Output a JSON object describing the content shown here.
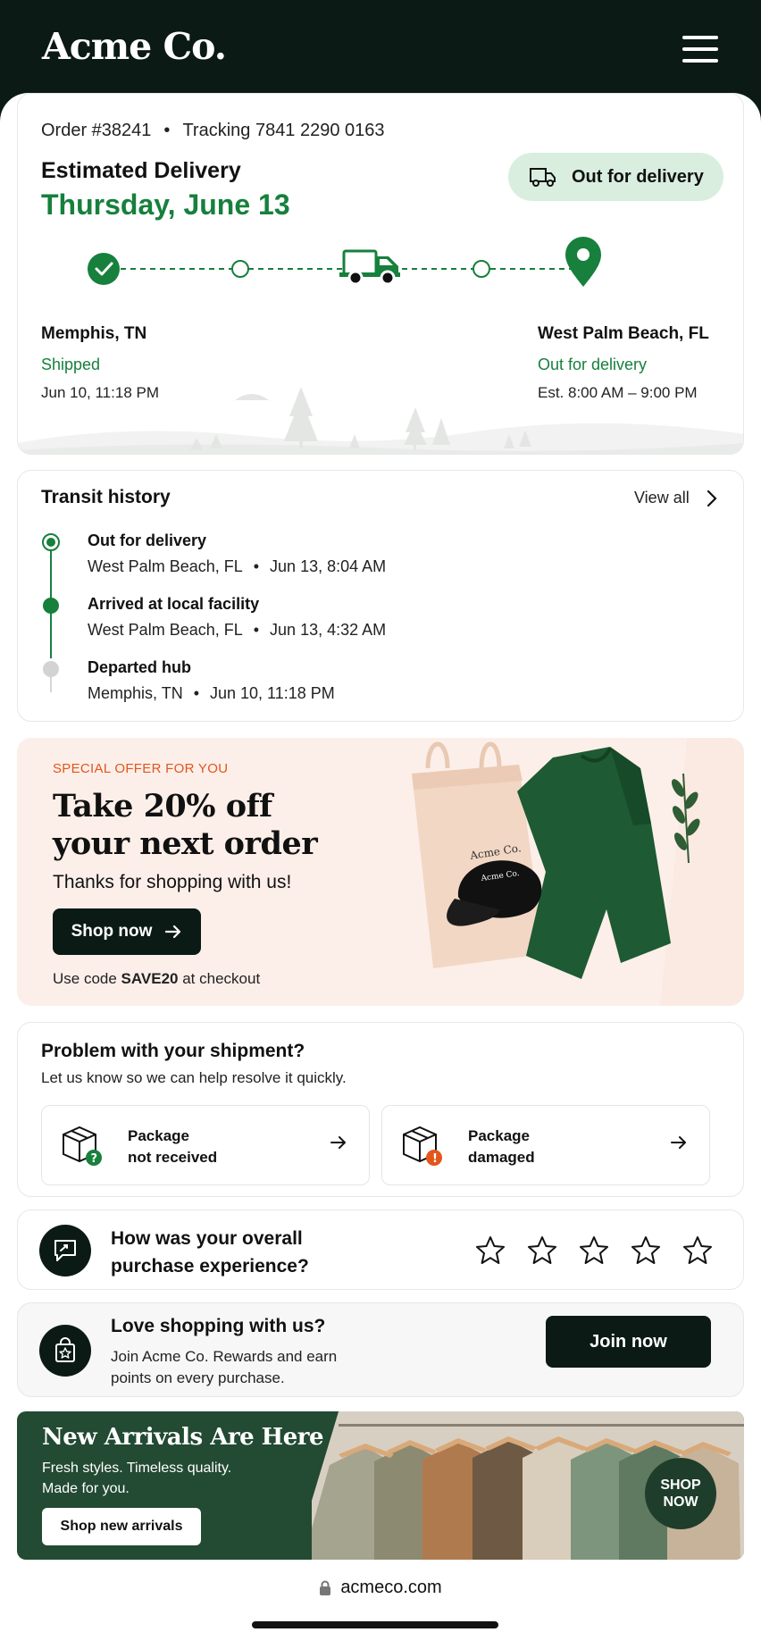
{
  "app": {
    "brand": "Acme Co."
  },
  "order": {
    "number": "Order #38241",
    "separator": "•",
    "tracking": "Tracking 7841 2290 0163",
    "estimated_label": "Estimated Delivery",
    "estimated_date": "Thursday, June 13",
    "status_pill": "Out for delivery"
  },
  "route": {
    "origin": {
      "city": "Memphis, TN",
      "status": "Shipped",
      "time": "Jun 10, 11:18 PM"
    },
    "destination": {
      "city": "West Palm Beach, FL",
      "status": "Out for delivery",
      "time": "Est. 8:00 AM – 9:00 PM"
    }
  },
  "transit": {
    "title": "Transit history",
    "view_all": "View all",
    "events": [
      {
        "title": "Out for delivery",
        "location": "West Palm Beach, FL",
        "time": "Jun 13, 8:04 AM"
      },
      {
        "title": "Arrived at local facility",
        "location": "West Palm Beach, FL",
        "time": "Jun 13, 4:32 AM"
      },
      {
        "title": "Departed hub",
        "location": "Memphis, TN",
        "time": "Jun 10, 11:18 PM"
      }
    ]
  },
  "promo": {
    "kicker": "SPECIAL OFFER FOR YOU",
    "headline": "Take 20% off your next order",
    "subtitle": "Thanks for shopping with us!",
    "button": "Shop now",
    "code_prefix": "Use code ",
    "code": "SAVE20",
    "code_suffix": " at checkout",
    "product_brand": "Acme Co."
  },
  "problem": {
    "title": "Problem with your shipment?",
    "subtitle": "Let us know so we can help resolve it quickly.",
    "options": [
      {
        "line1": "Package",
        "line2": "not received"
      },
      {
        "line1": "Package",
        "line2": "damaged"
      }
    ]
  },
  "rating": {
    "question": "How was your overall purchase experience?",
    "max_stars": 5,
    "selected": 0
  },
  "rewards": {
    "title": "Love shopping with us?",
    "subtitle": "Join Acme Co. Rewards and earn points on every purchase.",
    "button": "Join now"
  },
  "arrivals": {
    "title": "New Arrivals Are Here",
    "subtitle": "Fresh styles. Timeless quality. Made for you.",
    "button": "Shop new arrivals",
    "badge_line1": "SHOP",
    "badge_line2": "NOW"
  },
  "browser": {
    "url": "acmeco.com"
  },
  "colors": {
    "accent_green": "#16803c",
    "dark": "#0b1a14",
    "pill_bg": "#d9eedf",
    "promo_bg": "#fcefe9",
    "kicker_orange": "#e2561c"
  }
}
